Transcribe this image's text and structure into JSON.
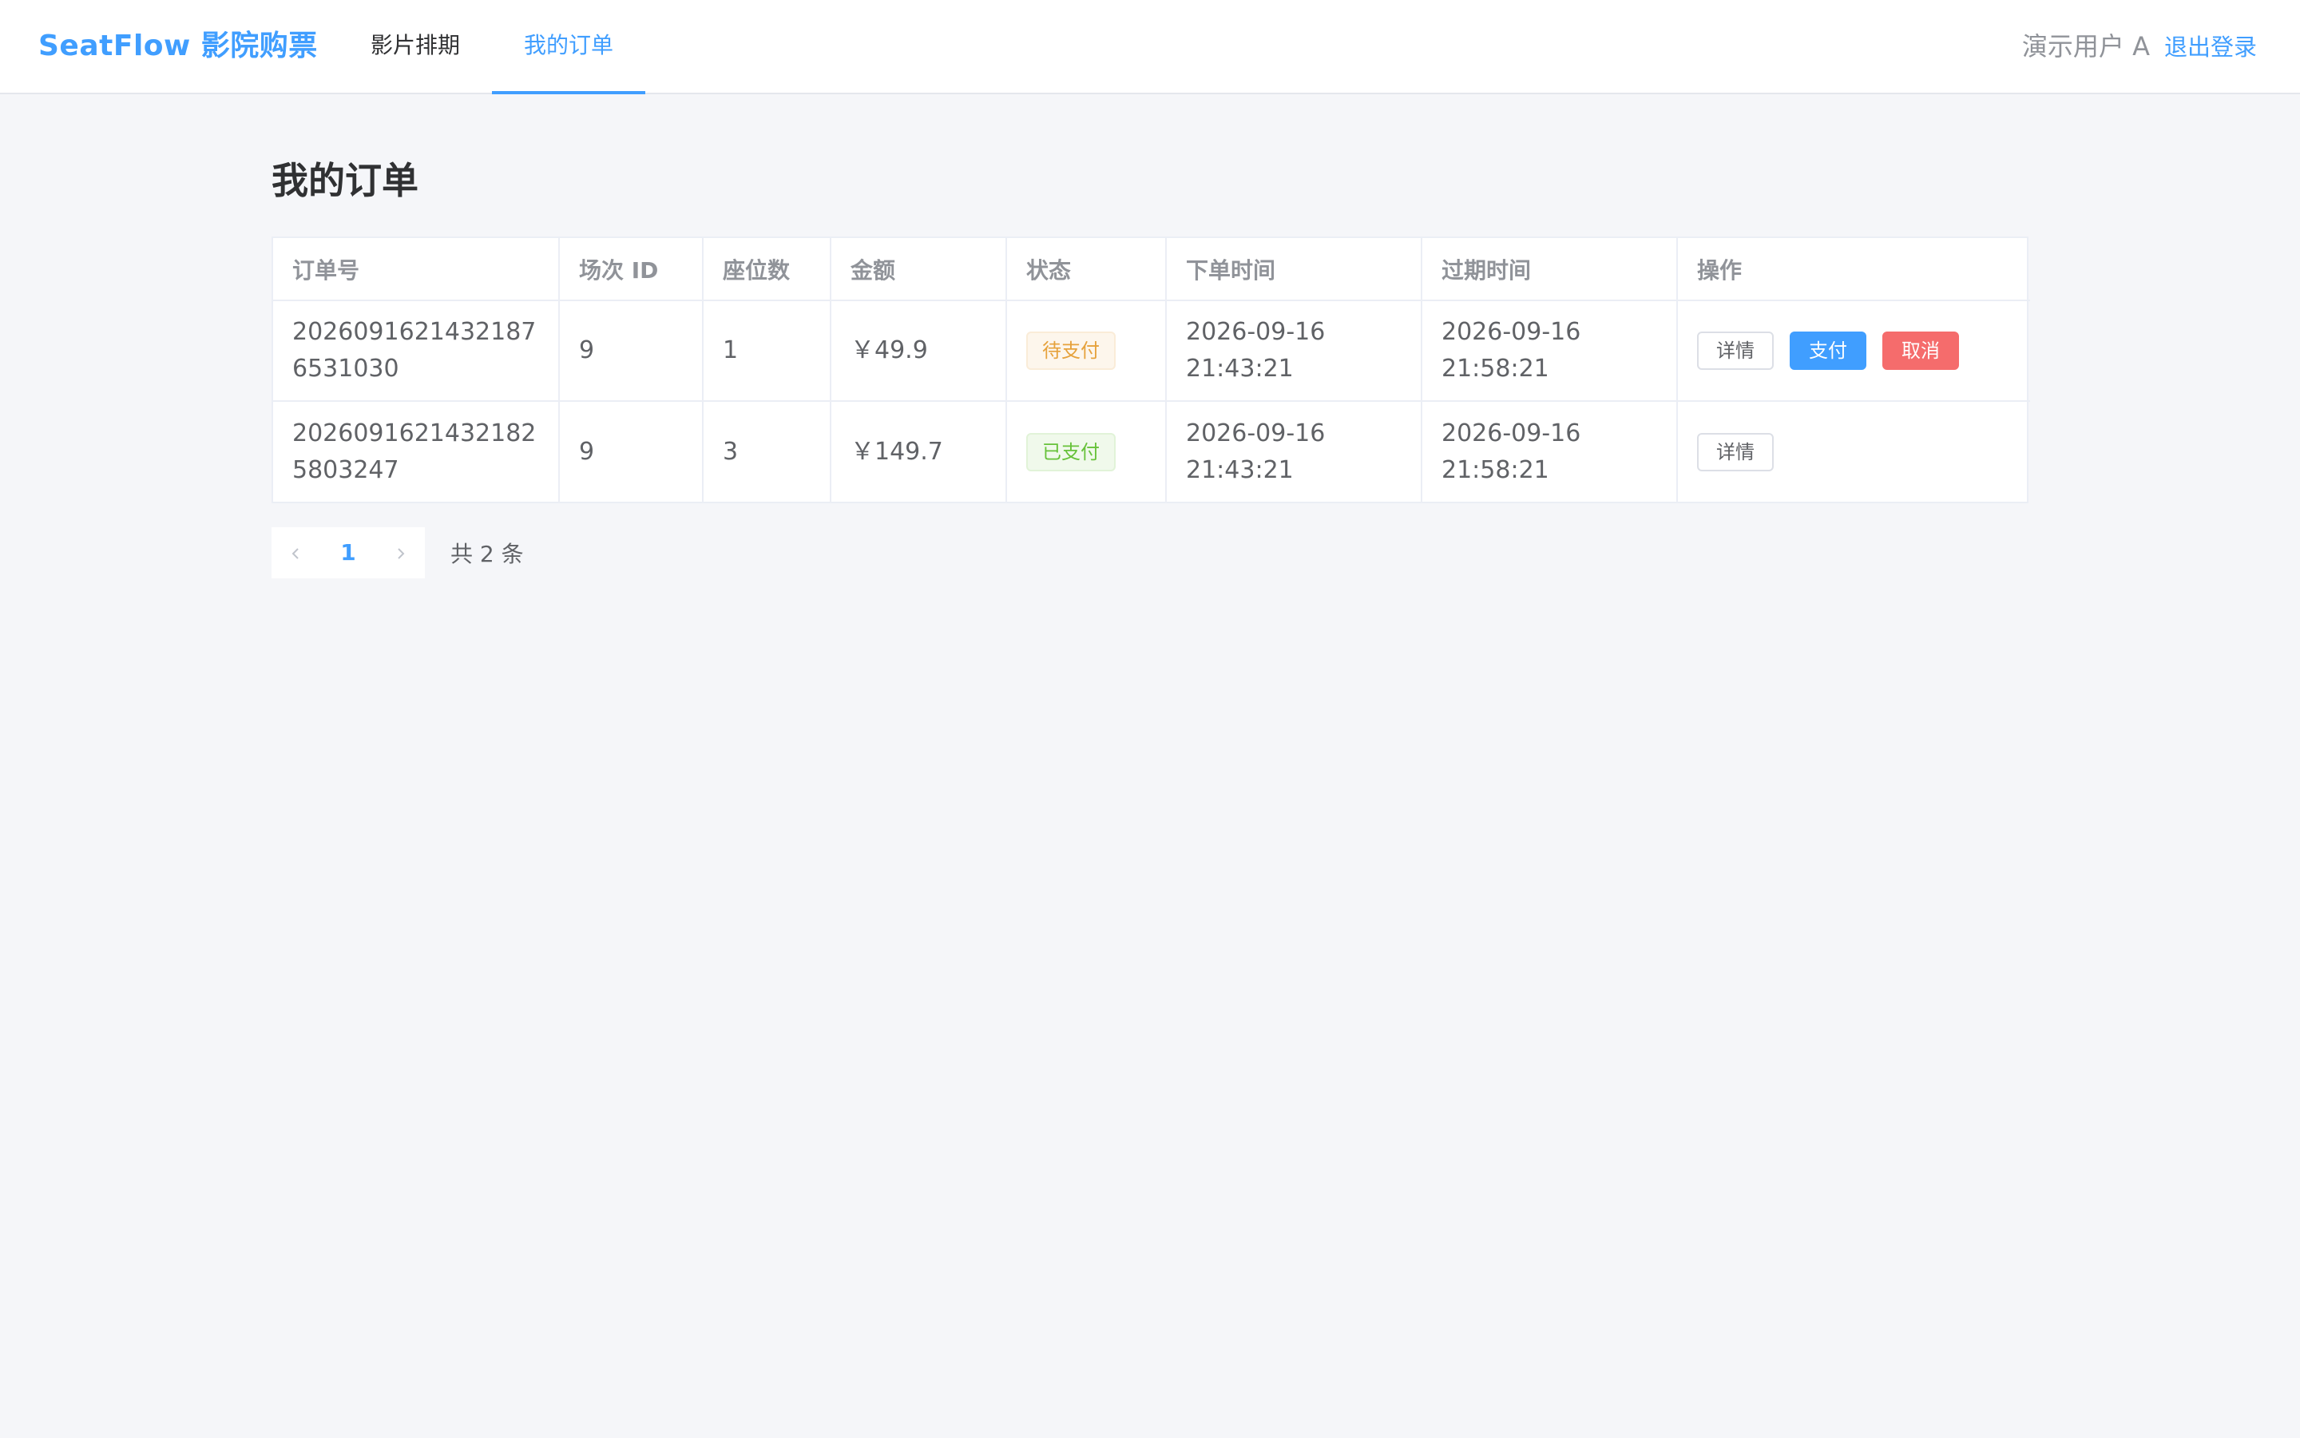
{
  "header": {
    "brand": "SeatFlow 影院购票",
    "tabs": [
      {
        "label": "影片排期"
      },
      {
        "label": "我的订单"
      }
    ],
    "user_name": "演示用户 A",
    "logout_label": "退出登录"
  },
  "main": {
    "title": "我的订单",
    "table": {
      "columns": [
        "订单号",
        "场次 ID",
        "座位数",
        "金额",
        "状态",
        "下单时间",
        "过期时间",
        "操作"
      ],
      "rows": [
        {
          "order_no": "20260916214321876531030",
          "session_id": "9",
          "seats": "1",
          "amount": "￥49.9",
          "status": "待支付",
          "created": "2026-09-16 21:43:21",
          "expires": "2026-09-16 21:58:21",
          "actions": [
            "详情",
            "支付",
            "取消"
          ]
        },
        {
          "order_no": "20260916214321825803247",
          "session_id": "9",
          "seats": "3",
          "amount": "￥149.7",
          "status": "已支付",
          "created": "2026-09-16 21:43:21",
          "expires": "2026-09-16 21:58:21",
          "actions": [
            "详情"
          ]
        }
      ]
    },
    "pagination": {
      "prev_icon": "chevron-left-icon",
      "next_icon": "chevron-right-icon",
      "current_page": "1",
      "total_text": "共 2 条"
    }
  },
  "colors": {
    "accent": "#409eff",
    "danger": "#f56c6c",
    "warning": "#e6a23c",
    "success": "#67c23a",
    "background": "#f5f6f9"
  }
}
